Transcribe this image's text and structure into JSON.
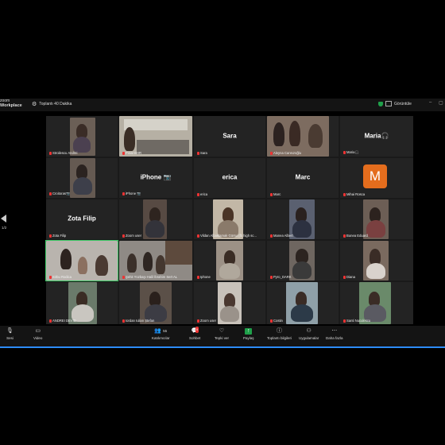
{
  "app": {
    "brand_line1": "zoom",
    "brand_line2": "Workplace",
    "meeting_title": "Toplantı 40 Dakika",
    "view_label": "Görüntüle"
  },
  "pager": {
    "page": "1/2"
  },
  "participants": [
    {
      "name": "Stroilescu Andrei"
    },
    {
      "name": "Pınar EHR"
    },
    {
      "name": "Sara"
    },
    {
      "name": "Aleyna Cansızoğlu"
    },
    {
      "name": "Maria🎧"
    },
    {
      "name": "Croitoras📷"
    },
    {
      "name": "iPhone 📷"
    },
    {
      "name": "erica"
    },
    {
      "name": "Marc"
    },
    {
      "name": "Mihai Rosca"
    },
    {
      "name": "Zota Filip"
    },
    {
      "name": "Zoom user"
    },
    {
      "name": "Vildan Albaktamak Gürsu (fb high sc..."
    },
    {
      "name": "Manea Albert"
    },
    {
      "name": "Bunea Eduard"
    },
    {
      "name": "Sirbu Rodica"
    },
    {
      "name": "Şehit Yüzbaşı Halil İbrahim Sert AL"
    },
    {
      "name": "Iphone"
    },
    {
      "name": "Pyro_DARK"
    },
    {
      "name": "Diana"
    },
    {
      "name": "ANDREI DEVID"
    },
    {
      "name": "Iordan Iulian Ștefan"
    },
    {
      "name": "Zoom user"
    },
    {
      "name": "Costin"
    },
    {
      "name": "Santi Nuculescu"
    }
  ],
  "tile_big_names": {
    "sara": "Sara",
    "maria": "Maria🎧",
    "iphone": "iPhone 📷",
    "erica": "erica",
    "marc": "Marc",
    "zota": "Zota Filip"
  },
  "avatar_letter": "M",
  "toolbar": {
    "mic": "Sesi",
    "video": "Video",
    "participants": "Katılımcılar",
    "participants_count": "55",
    "chat": "Sohbet",
    "chat_badge": "5",
    "react": "Tepki ver",
    "share": "Paylaş",
    "info": "Toplantı bilgileri",
    "apps": "Uygulamalar",
    "more": "Daha fazla"
  },
  "colors": {
    "accent": "#2d8cff",
    "active_speaker": "#3cc865",
    "avatar": "#e46d1d",
    "muted": "#e33333"
  }
}
